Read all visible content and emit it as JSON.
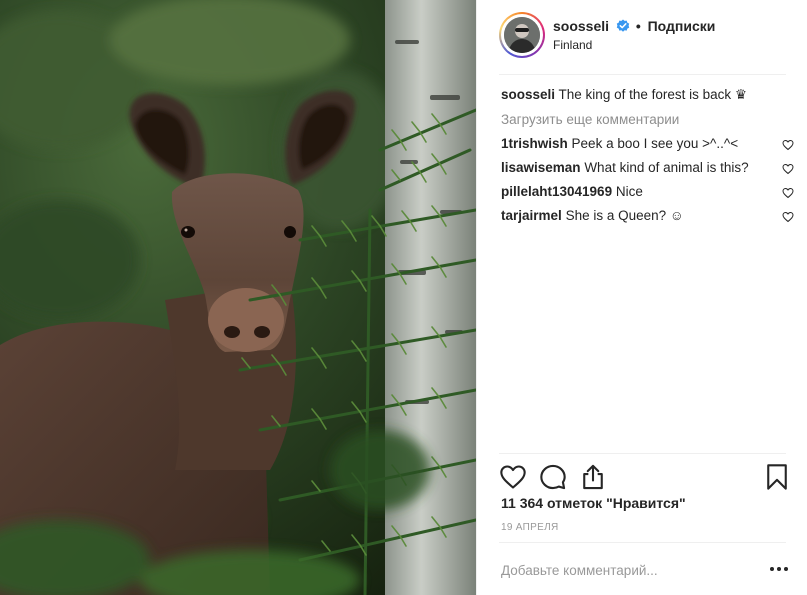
{
  "post": {
    "username": "soosseli",
    "separator": "•",
    "follow_status": "Подписки",
    "location": "Finland",
    "caption": {
      "username": "soosseli",
      "text": "The king of the forest is back ♛"
    },
    "load_more_label": "Загрузить еще комментарии",
    "comments": [
      {
        "username": "1trishwish",
        "text": "Peek a boo I see you >^..^<"
      },
      {
        "username": "lisawiseman",
        "text": "What kind of animal is this?"
      },
      {
        "username": "pillelaht13041969",
        "text": "Nice"
      },
      {
        "username": "tarjairmel",
        "text": "She is a Queen? ☺"
      }
    ],
    "likes_text": "11 364 отметок \"Нравится\"",
    "date": "19 АПРЕЛЯ",
    "add_comment_placeholder": "Добавьте комментарий...",
    "more_label": "•••"
  },
  "colors": {
    "verified": "#3897f0",
    "text": "#262626",
    "muted": "#8e8e8e",
    "divider": "#efefef"
  },
  "icons": [
    "verified-badge-icon",
    "heart-icon",
    "comment-icon",
    "share-icon",
    "bookmark-icon",
    "more-icon"
  ]
}
